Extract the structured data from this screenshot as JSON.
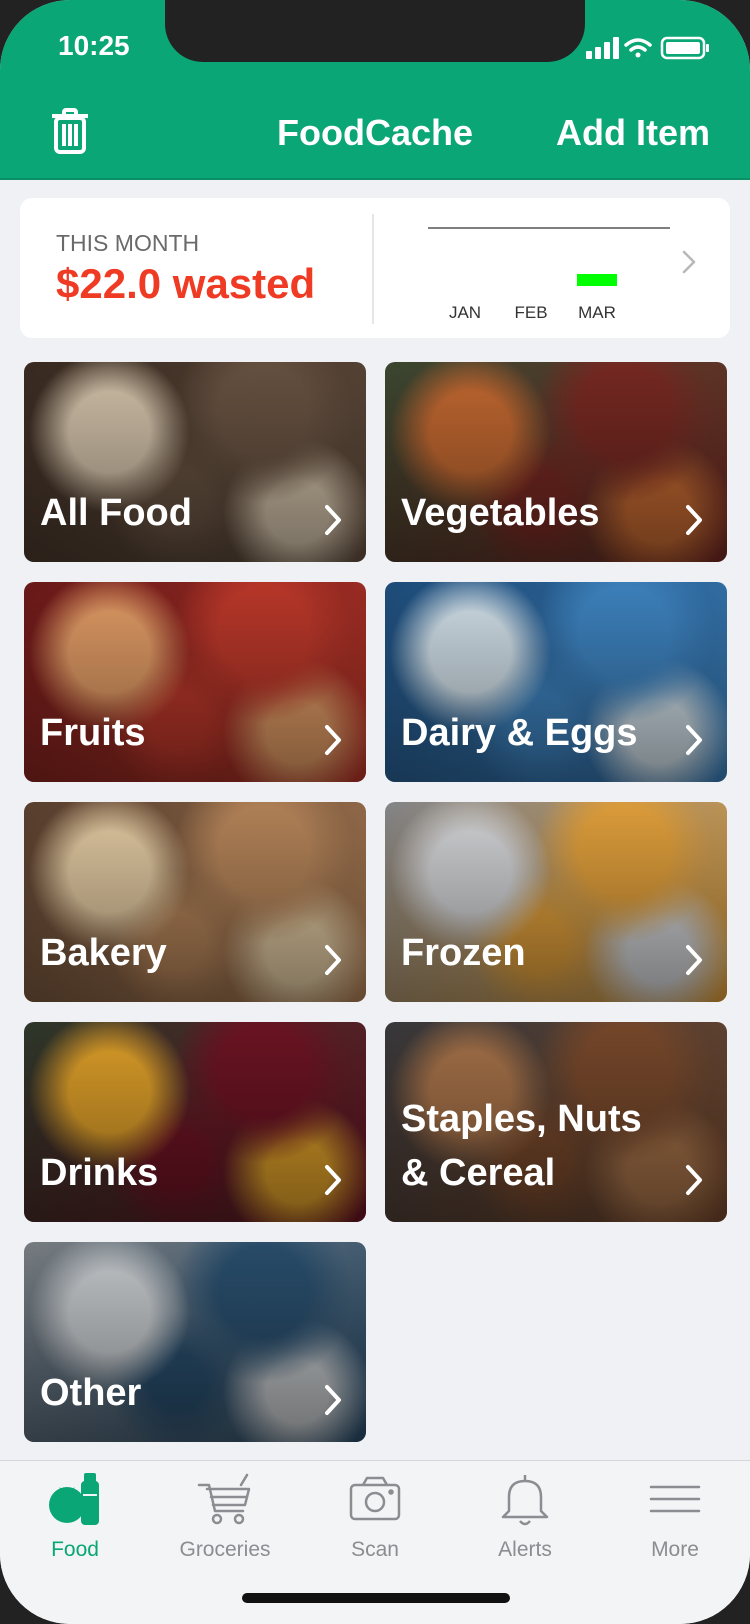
{
  "status": {
    "time": "10:25"
  },
  "nav": {
    "title": "FoodCache",
    "add_label": "Add Item",
    "trash_icon": "trash-icon"
  },
  "summary": {
    "label": "THIS MONTH",
    "amount": "$22.0 wasted",
    "accent": "#ef3a24",
    "chart_data": {
      "type": "bar",
      "categories": [
        "JAN",
        "FEB",
        "MAR"
      ],
      "values": [
        0,
        0,
        22.0
      ],
      "bar_color": "#00ff00",
      "xlabel": "",
      "ylabel": ""
    }
  },
  "categories": [
    {
      "label": "All Food",
      "colors": [
        "#3b2c22",
        "#6a5443",
        "#d8c7ae"
      ]
    },
    {
      "label": "Vegetables",
      "colors": [
        "#3c4a32",
        "#7a2a23",
        "#c86b32"
      ]
    },
    {
      "label": "Fruits",
      "colors": [
        "#6e1a1a",
        "#c0392b",
        "#e8a068"
      ]
    },
    {
      "label": "Dairy & Eggs",
      "colors": [
        "#1f4f7f",
        "#3f86c4",
        "#d7e6ef"
      ]
    },
    {
      "label": "Bakery",
      "colors": [
        "#5b4130",
        "#b9875b",
        "#e8cfa6"
      ]
    },
    {
      "label": "Frozen",
      "colors": [
        "#8a8b8f",
        "#e7a43d",
        "#d9dadd"
      ]
    },
    {
      "label": "Drinks",
      "colors": [
        "#2f3a2b",
        "#6f1424",
        "#e3a32a"
      ]
    },
    {
      "label": "Staples, Nuts\n& Cereal",
      "colors": [
        "#3a3a3d",
        "#7a4a2c",
        "#a9744a"
      ]
    },
    {
      "label": "Other",
      "colors": [
        "#7d8287",
        "#2a4f6e",
        "#c9cdd0"
      ]
    }
  ],
  "tabs": [
    {
      "label": "Food",
      "icon": "food-icon",
      "active": true
    },
    {
      "label": "Groceries",
      "icon": "cart-icon",
      "active": false
    },
    {
      "label": "Scan",
      "icon": "camera-icon",
      "active": false
    },
    {
      "label": "Alerts",
      "icon": "bell-icon",
      "active": false
    },
    {
      "label": "More",
      "icon": "menu-icon",
      "active": false
    }
  ],
  "colors": {
    "brand": "#0aa675",
    "tab_inactive": "#8a8d91"
  }
}
